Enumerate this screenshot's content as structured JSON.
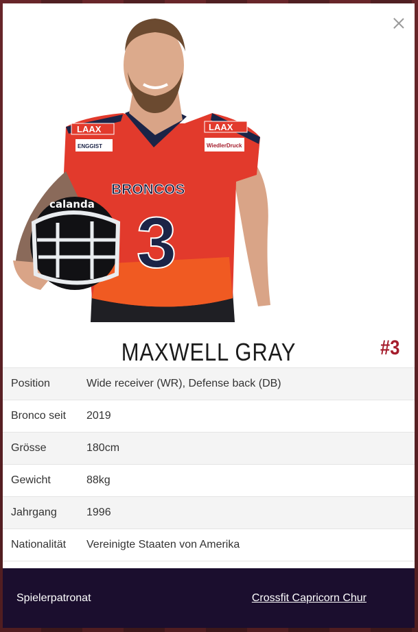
{
  "player": {
    "name": "MAXWELL GRAY",
    "number": "#3",
    "jersey": {
      "team": "BRONCOS",
      "number": "3",
      "sponsor_top": "LAAX",
      "sponsor_left": "ENGGIST",
      "sponsor_right": "WiedlerDruck",
      "helmet_sponsor": "calanda"
    }
  },
  "info": [
    {
      "label": "Position",
      "value": "Wide receiver (WR), Defense back (DB)"
    },
    {
      "label": "Bronco seit",
      "value": "2019"
    },
    {
      "label": "Grösse",
      "value": "180cm"
    },
    {
      "label": "Gewicht",
      "value": "88kg"
    },
    {
      "label": "Jahrgang",
      "value": "1996"
    },
    {
      "label": "Nationalität",
      "value": "Vereinigte Staaten von Amerika"
    }
  ],
  "footer": {
    "label": "Spielerpatronat",
    "sponsor_link": "Crossfit Capricorn Chur"
  },
  "colors": {
    "accent": "#a51d2c",
    "jersey_red": "#e23a2c",
    "navy": "#1b2447",
    "footer_bg": "#1b0e2e"
  }
}
